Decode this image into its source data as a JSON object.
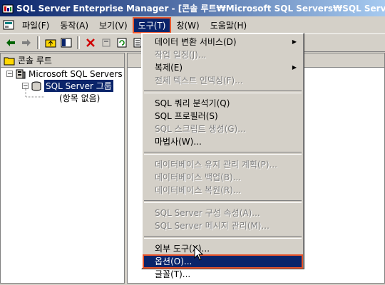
{
  "window": {
    "title": "SQL Server Enterprise Manager - [콘솔 루트₩Microsoft SQL Servers₩SQL Server 그룹]"
  },
  "menubar": {
    "items": [
      "파일(F)",
      "동작(A)",
      "보기(V)",
      "도구(T)",
      "창(W)",
      "도움말(H)"
    ],
    "selected": "도구(T)"
  },
  "tree": {
    "header": "콘솔 루트",
    "servers": "Microsoft SQL Servers",
    "group": "SQL Server 그룹",
    "empty": "(항목 없음)"
  },
  "tools_menu": {
    "group1": [
      {
        "label": "데이터 변환 서비스(D)",
        "disabled": false,
        "submenu": true
      },
      {
        "label": "작업 일정(J)...",
        "disabled": true
      },
      {
        "label": "복제(E)",
        "disabled": false,
        "submenu": true
      },
      {
        "label": "전체 텍스트 인덱싱(F)...",
        "disabled": true
      }
    ],
    "group2": [
      {
        "label": "SQL 쿼리 분석기(Q)",
        "disabled": false
      },
      {
        "label": "SQL 프로필러(S)",
        "disabled": false
      },
      {
        "label": "SQL 스크립트 생성(G)...",
        "disabled": true
      },
      {
        "label": "마법사(W)...",
        "disabled": false
      }
    ],
    "group3": [
      {
        "label": "데이터베이스 유지 관리 계획(P)...",
        "disabled": true
      },
      {
        "label": "데이터베이스 백업(B)...",
        "disabled": true
      },
      {
        "label": "데이터베이스 복원(R)...",
        "disabled": true
      }
    ],
    "group4": [
      {
        "label": "SQL Server 구성 속성(A)...",
        "disabled": true
      },
      {
        "label": "SQL Server 메시지 관리(M)...",
        "disabled": true
      }
    ],
    "group5": [
      {
        "label": "외부 도구(X)...",
        "disabled": false
      },
      {
        "label": "옵션(O)...",
        "disabled": false,
        "highlighted": true
      },
      {
        "label": "글꼴(T)...",
        "disabled": false
      }
    ]
  },
  "colors": {
    "selection": "#0a246a",
    "highlight_outline": "#e8552b",
    "face": "#d4d0c8"
  }
}
